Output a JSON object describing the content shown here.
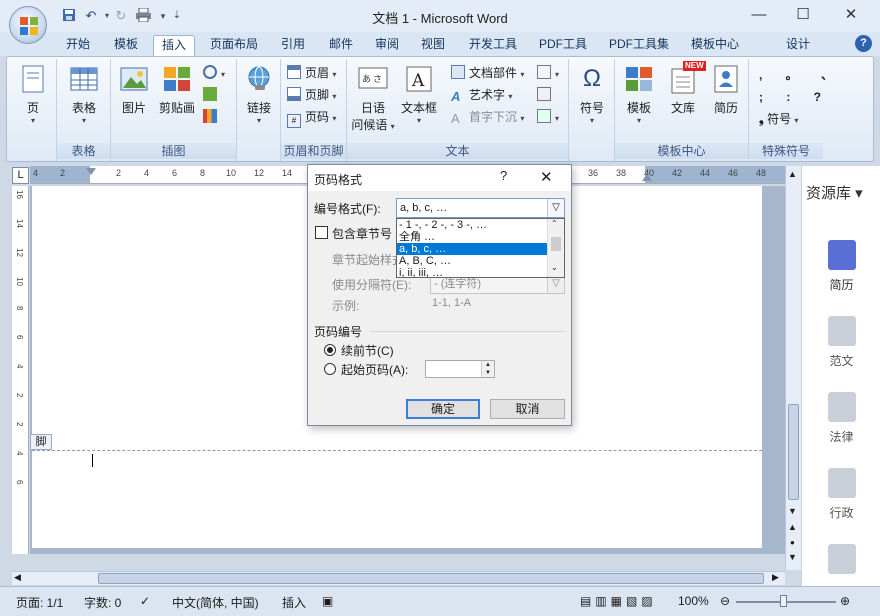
{
  "window": {
    "title": "文档 1 - Microsoft Word",
    "controls": [
      "minimize-icon",
      "maximize-icon",
      "close-icon"
    ]
  },
  "qat": {
    "items": [
      "save-icon",
      "undo-icon",
      "redo-icon",
      "print-icon",
      "customize-icon"
    ]
  },
  "tabs": [
    {
      "label": "开始",
      "active": false
    },
    {
      "label": "模板",
      "active": false
    },
    {
      "label": "插入",
      "active": true
    },
    {
      "label": "页面布局",
      "active": false
    },
    {
      "label": "引用",
      "active": false
    },
    {
      "label": "邮件",
      "active": false
    },
    {
      "label": "审阅",
      "active": false
    },
    {
      "label": "视图",
      "active": false
    },
    {
      "label": "开发工具",
      "active": false
    },
    {
      "label": "PDF工具",
      "active": false
    },
    {
      "label": "PDF工具集",
      "active": false
    },
    {
      "label": "模板中心",
      "active": false
    },
    {
      "label": "设计",
      "active": false
    }
  ],
  "ribbon": {
    "groups": {
      "page": {
        "label": "",
        "button": "页"
      },
      "table": {
        "label": "表格",
        "button": "表格"
      },
      "illustrations": {
        "label": "插图",
        "picture": "图片",
        "clipart": "剪贴画"
      },
      "links": {
        "label": "",
        "button": "链接"
      },
      "header_footer": {
        "label": "页眉和页脚",
        "header": "页眉",
        "footer": "页脚",
        "page_number": "页码"
      },
      "text": {
        "label": "文本",
        "japanese": "日语",
        "japanese2": "问候语",
        "textbox": "文本框",
        "quickparts": "文档部件",
        "wordart": "艺术字",
        "dropcap": "首字下沉"
      },
      "symbols": {
        "label": "",
        "button": "符号"
      },
      "template_center": {
        "label": "模板中心",
        "template": "模板",
        "library": "文库",
        "resume": "简历",
        "new_badge": "NEW"
      },
      "special_symbols": {
        "label": "特殊符号",
        "button": "符号",
        "row1": ", 。 、",
        "row2": "; : ?"
      }
    }
  },
  "ruler": {
    "ticks": [
      "4",
      "2",
      "2",
      "4",
      "6",
      "8",
      "10",
      "12",
      "14",
      "36",
      "38",
      "40",
      "42",
      "44",
      "46",
      "48"
    ],
    "vticks": [
      "16",
      "14",
      "12",
      "10",
      "8",
      "6",
      "4",
      "2",
      "2",
      "4",
      "6"
    ]
  },
  "document": {
    "footer_tag": "脚"
  },
  "sidebar": {
    "title": "资源库",
    "items": [
      {
        "label": "简历",
        "icon": "resume-icon",
        "active": true
      },
      {
        "label": "范文",
        "icon": "sample-icon",
        "active": false
      },
      {
        "label": "法律",
        "icon": "law-icon",
        "active": false
      },
      {
        "label": "行政",
        "icon": "admin-icon",
        "active": false
      }
    ]
  },
  "dialog": {
    "title": "页码格式",
    "help": "?",
    "number_format_label": "编号格式(F):",
    "number_format_value": "a, b, c, …",
    "options": [
      "- 1 -, - 2 -, - 3 -, …",
      "全角 …",
      "a, b, c, …",
      "A, B, C, …",
      "i, ii, iii, …"
    ],
    "selected_index": 2,
    "include_chapter_label": "包含章节号",
    "chapter_start_label": "章节起始样式",
    "separator_label": "使用分隔符(E):",
    "separator_value": "- (连字符)",
    "example_label": "示例:",
    "example_value": "1-1, 1-A",
    "numbering_section": "页码编号",
    "continue_label": "续前节(C)",
    "start_at_label": "起始页码(A):",
    "ok": "确定",
    "cancel": "取消"
  },
  "status": {
    "page": "页面: 1/1",
    "words": "字数: 0",
    "language": "中文(简体, 中国)",
    "mode": "插入",
    "zoom": "100%"
  },
  "colors": {
    "accent": "#2d62b1",
    "selection": "#0078d7",
    "ribbon_bg": "#dfe9f6"
  }
}
